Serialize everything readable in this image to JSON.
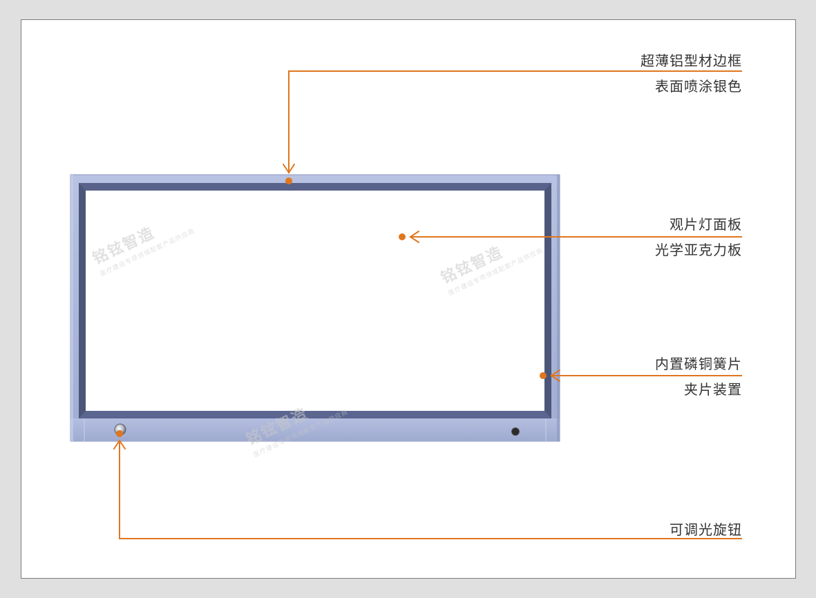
{
  "colors": {
    "callout": "#e0761e",
    "frame_outer": "#a7b3d6",
    "frame_inner": "#4a5477",
    "panel": "#ffffff"
  },
  "callouts": [
    {
      "id": "frame",
      "lines": [
        "超薄铝型材边框",
        "表面喷涂银色"
      ]
    },
    {
      "id": "panel",
      "lines": [
        "观片灯面板",
        "光学亚克力板"
      ]
    },
    {
      "id": "clip",
      "lines": [
        "内置磷铜簧片",
        "夹片装置"
      ]
    },
    {
      "id": "knob",
      "lines": [
        "可调光旋钮"
      ]
    }
  ],
  "watermark": {
    "brand": "铭铉智造",
    "tagline": "医疗建设专项领域配套产品供应商"
  }
}
